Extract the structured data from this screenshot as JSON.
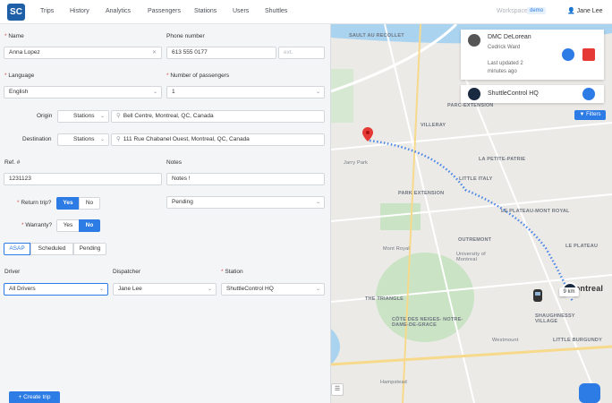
{
  "nav": {
    "logo": "SC",
    "items": [
      "Trips",
      "History",
      "Analytics",
      "Passengers",
      "Stations",
      "Users",
      "Shuttles"
    ],
    "workspace_label": "Workspace",
    "workspace_badge": "demo",
    "user_name": "Jane Lee"
  },
  "form": {
    "name_label": "Name",
    "name_value": "Anna Lopez",
    "phone_label": "Phone number",
    "phone_value": "613 555 0177",
    "ext_placeholder": "ext.",
    "language_label": "Language",
    "language_value": "English",
    "passengers_label": "Number of passengers",
    "passengers_value": "1",
    "origin_label": "Origin",
    "origin_type": "Stations",
    "origin_value": "Bell Centre, Montreal, QC, Canada",
    "destination_label": "Destination",
    "destination_type": "Stations",
    "destination_value": "111 Rue Chabanel Ouest, Montreal, QC, Canada",
    "ref_label": "Ref. #",
    "ref_value": "1231123",
    "notes_label": "Notes",
    "notes_value": "Notes !",
    "return_label": "Return trip?",
    "return_yes": "Yes",
    "return_no": "No",
    "status_value": "Pending",
    "warranty_label": "Warranty?",
    "warranty_yes": "Yes",
    "warranty_no": "No",
    "tabs": [
      "ASAP",
      "Scheduled",
      "Pending"
    ],
    "driver_label": "Driver",
    "driver_value": "All Drivers",
    "dispatcher_label": "Dispatcher",
    "dispatcher_value": "Jane Lee",
    "station_label": "Station",
    "station_value": "ShuttleControl HQ",
    "create_button": "Create trip"
  },
  "map": {
    "vehicle_name": "DMC DeLorean",
    "driver_name": "Cedrick Ward",
    "last_updated": "Last updated 2 minutes ago",
    "hq_name": "ShuttleControl HQ",
    "filters_label": "Filters",
    "distance": "9 km",
    "labels": [
      "SAULT AU RECOLLET",
      "PARC-EXTENSION",
      "VILLERAY",
      "LA PETITE-PATRIE",
      "PARK EXTENSION",
      "LITTLE ITALY",
      "LE PLATEAU-MONT ROYAL",
      "OUTREMONT",
      "University of Montreal",
      "Mont Royal",
      "Jarry Park",
      "Montreal",
      "Westmount",
      "Hampstead",
      "LE PLATEAU",
      "CÔTE DES NEIGES- NOTRE-DAME-DE-GRACE",
      "THE TRIANGLE",
      "LITTLE BURGUNDY",
      "SHAUGHNESSY VILLAGE"
    ]
  },
  "colors": {
    "accent": "#2d7be5",
    "route": "#4a86e8",
    "pin": "#e53935"
  }
}
